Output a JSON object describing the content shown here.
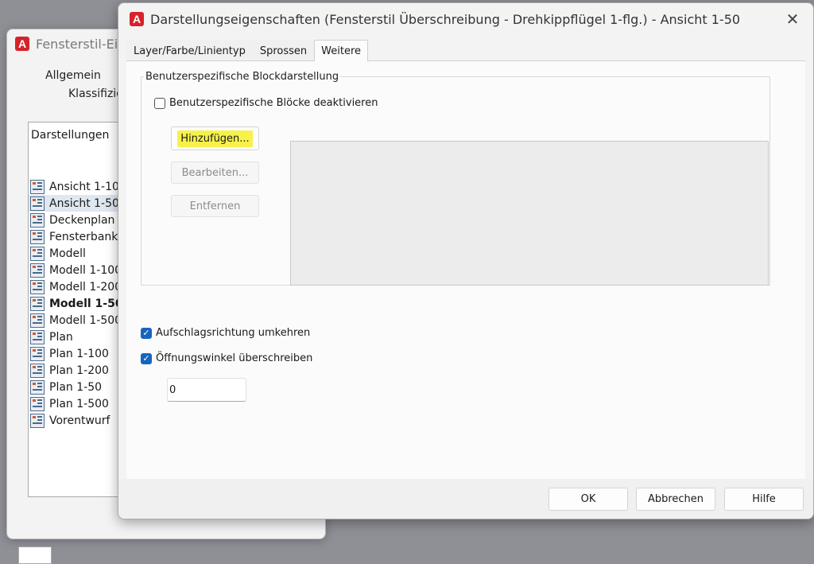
{
  "bg_window": {
    "title": "Fensterstil-Eige",
    "tab_general": "Allgemein",
    "tab_classification": "Klassifizier",
    "list_header": "Darstellungen",
    "items": [
      {
        "label": "Ansicht 1-100",
        "selected": false,
        "bold": false
      },
      {
        "label": "Ansicht 1-50",
        "selected": true,
        "bold": false
      },
      {
        "label": "Deckenplan",
        "selected": false,
        "bold": false
      },
      {
        "label": "Fensterbank",
        "selected": false,
        "bold": false
      },
      {
        "label": "Modell",
        "selected": false,
        "bold": false
      },
      {
        "label": "Modell 1-100",
        "selected": false,
        "bold": false
      },
      {
        "label": "Modell 1-200",
        "selected": false,
        "bold": false
      },
      {
        "label": "Modell 1-50",
        "selected": false,
        "bold": true
      },
      {
        "label": "Modell 1-500",
        "selected": false,
        "bold": false
      },
      {
        "label": "Plan",
        "selected": false,
        "bold": false
      },
      {
        "label": "Plan 1-100",
        "selected": false,
        "bold": false
      },
      {
        "label": "Plan 1-200",
        "selected": false,
        "bold": false
      },
      {
        "label": "Plan 1-50",
        "selected": false,
        "bold": false
      },
      {
        "label": "Plan 1-500",
        "selected": false,
        "bold": false
      },
      {
        "label": "Vorentwurf",
        "selected": false,
        "bold": false
      }
    ]
  },
  "dialog": {
    "title": "Darstellungseigenschaften (Fensterstil Überschreibung - Drehkippflügel 1-flg.) - Ansicht 1-50",
    "close_glyph": "✕",
    "tabs": [
      "Layer/Farbe/Linientyp",
      "Sprossen",
      "Weitere"
    ],
    "active_tab": 2,
    "group_label": "Benutzerspezifische Blockdarstellung",
    "disable_blocks_label": "Benutzerspezifische Blöcke deaktivieren",
    "disable_blocks_checked": false,
    "add_button": "Hinzufügen...",
    "edit_button": "Bearbeiten...",
    "remove_button": "Entfernen",
    "swing_label": "Aufschlagsrichtung umkehren",
    "swing_checked": true,
    "angle_override_label": "Öffnungswinkel überschreiben",
    "angle_override_checked": true,
    "angle_value": "0",
    "ok_button": "OK",
    "cancel_button": "Abbrechen",
    "help_button": "Hilfe",
    "highlight_color": "#f7f24a",
    "checkbox_color": "#1565c0",
    "app_icon_color": "#d6222a"
  }
}
